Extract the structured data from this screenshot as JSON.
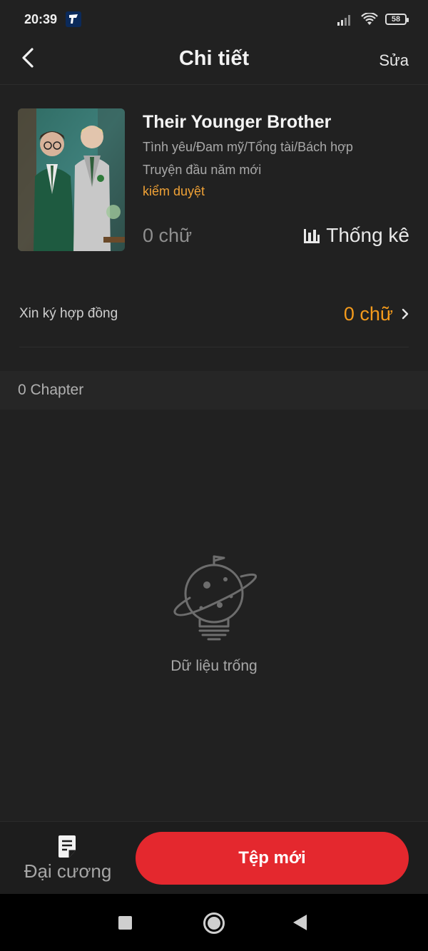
{
  "status_bar": {
    "time": "20:39",
    "battery": "58",
    "icons": [
      "app-notification-icon",
      "signal-icon",
      "wifi-icon",
      "battery-icon"
    ]
  },
  "header": {
    "back_icon": "chevron-left-icon",
    "title": "Chi tiết",
    "edit_label": "Sửa"
  },
  "book": {
    "title": "Their Younger Brother",
    "genres": "Tình yêu/Đam mỹ/Tổng tài/Bách hợp",
    "tagline": "Truyện đầu năm mới",
    "review_status": "kiểm duyệt",
    "word_count": "0 chữ",
    "stats_label": "Thống kê",
    "stats_icon": "bar-chart-icon"
  },
  "contract": {
    "label": "Xin ký hợp đồng",
    "value": "0 chữ",
    "chevron_icon": "chevron-right-icon"
  },
  "chapters": {
    "count_label": "0 Chapter"
  },
  "empty_state": {
    "icon": "planet-lightbulb-icon",
    "text": "Dữ liệu trống"
  },
  "bottom_bar": {
    "outline_label": "Đại cương",
    "outline_icon": "document-icon",
    "new_file_label": "Tệp mới"
  },
  "colors": {
    "background": "#212121",
    "accent_orange": "#f39a1c",
    "primary_red": "#e4282e"
  },
  "nav_bar": {
    "icons": [
      "recents-square-icon",
      "home-circle-icon",
      "back-triangle-icon"
    ]
  }
}
